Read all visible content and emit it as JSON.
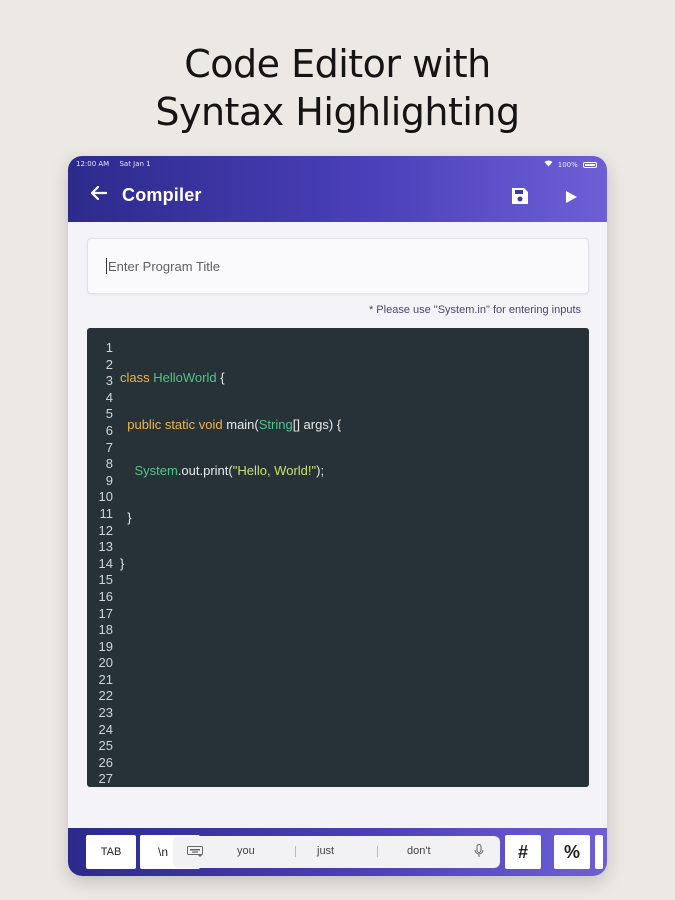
{
  "promo": {
    "headline_line1": "Code Editor with",
    "headline_line2": "Syntax Highlighting"
  },
  "status_bar": {
    "time": "12:00 AM",
    "date": "Sat Jan 1",
    "battery": "100%"
  },
  "app_bar": {
    "title": "Compiler",
    "back_icon": "arrow-back-icon",
    "save_icon": "floppy-save-icon",
    "run_icon": "play-icon"
  },
  "program_title_input": {
    "value": "",
    "placeholder": "Enter Program Title"
  },
  "input_hint": "* Please use \"System.in\" for entering inputs",
  "editor": {
    "language": "Java",
    "line_numbers": [
      "1",
      "2",
      "3",
      "4",
      "5",
      "6",
      "7",
      "8",
      "9",
      "10",
      "11",
      "12",
      "13",
      "14",
      "15",
      "16",
      "17",
      "18",
      "19",
      "20",
      "21",
      "22",
      "23",
      "24",
      "25",
      "26",
      "27"
    ],
    "code": {
      "l1": {
        "kw": "class",
        "cls": "HelloWorld",
        "rest": " {"
      },
      "l2": {
        "indent": "  ",
        "kw": "public static void",
        "plain": " main(",
        "cls": "String",
        "rest": "[] args) {"
      },
      "l3": {
        "indent": "    ",
        "cls": "System",
        "plain": ".out.print(",
        "str": "\"Hello, World!\"",
        "rest": ");"
      },
      "l4": "  }",
      "l5": "}"
    },
    "colors": {
      "background": "#263238",
      "keyword": "#f0b54a",
      "class": "#55c28b",
      "string": "#c8e06b"
    }
  },
  "symbol_keys": {
    "tab": "TAB",
    "newline": "\\n",
    "hash": "#",
    "percent": "%"
  },
  "keyboard_suggestions": {
    "words": [
      "you",
      "just",
      "don't"
    ],
    "keyboard_icon": "keyboard-icon",
    "mic_icon": "microphone-icon"
  },
  "theme": {
    "accent_start": "#2d2a8c",
    "accent_end": "#6e5fd6"
  }
}
